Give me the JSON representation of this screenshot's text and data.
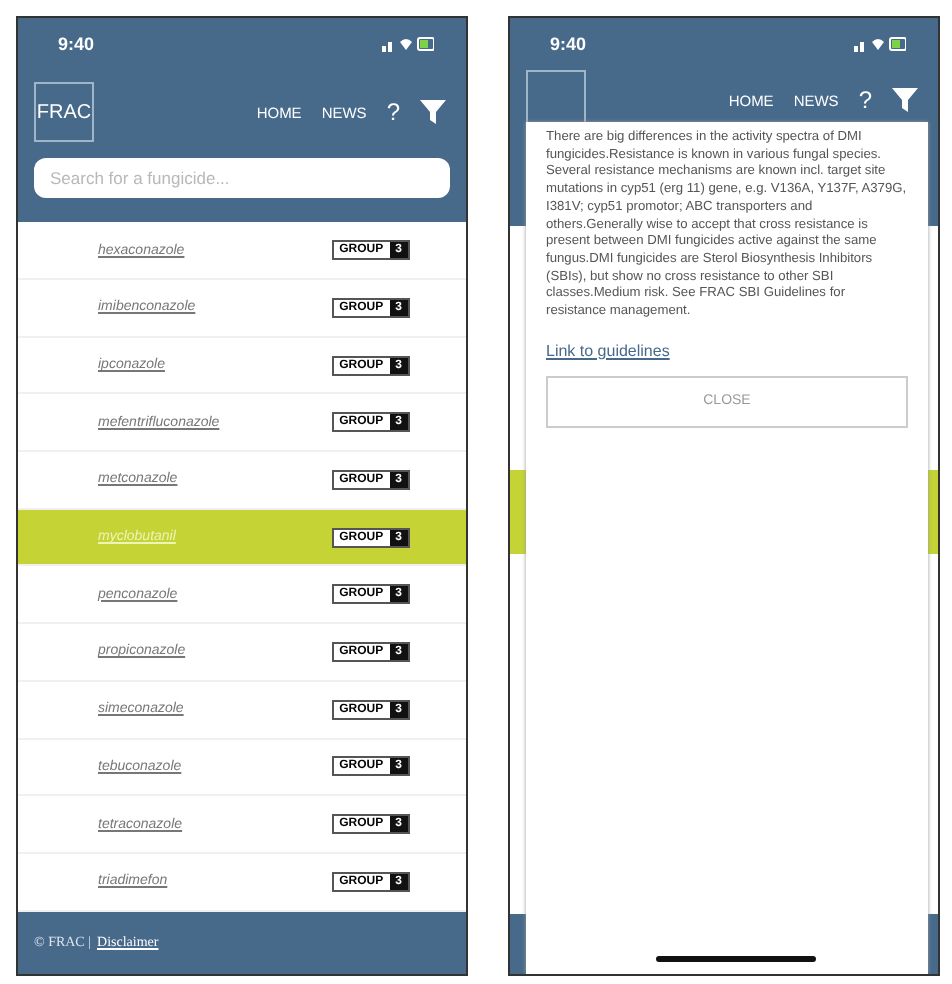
{
  "list_screen": {
    "status_time": "9:40",
    "logo": "FRAC",
    "nav": [
      {
        "label": "HOME",
        "kind": "text"
      },
      {
        "label": "NEWS",
        "kind": "text"
      },
      {
        "label": "?",
        "kind": "text"
      },
      {
        "kind": "filter"
      }
    ],
    "search": {
      "placeholder": "Search for a fungicide..."
    },
    "rows": [
      {
        "name": "hexaconazole",
        "badge": "GROUP",
        "group": "3",
        "selected": false
      },
      {
        "name": "imibenconazole",
        "badge": "GROUP",
        "group": "3",
        "selected": false
      },
      {
        "name": "ipconazole",
        "badge": "GROUP",
        "group": "3",
        "selected": false
      },
      {
        "name": "mefentrifluconazole",
        "badge": "GROUP",
        "group": "3",
        "selected": false
      },
      {
        "name": "metconazole",
        "badge": "GROUP",
        "group": "3",
        "selected": false
      },
      {
        "name": "myclobutanil",
        "badge": "GROUP",
        "group": "3",
        "selected": true
      },
      {
        "name": "penconazole",
        "badge": "GROUP",
        "group": "3",
        "selected": false
      },
      {
        "name": "propiconazole",
        "badge": "GROUP",
        "group": "3",
        "selected": false
      },
      {
        "name": "simeconazole",
        "badge": "GROUP",
        "group": "3",
        "selected": false
      },
      {
        "name": "tebuconazole",
        "badge": "GROUP",
        "group": "3",
        "selected": false
      },
      {
        "name": "tetraconazole",
        "badge": "GROUP",
        "group": "3",
        "selected": false
      },
      {
        "name": "triadimefon",
        "badge": "GROUP",
        "group": "3",
        "selected": false
      }
    ],
    "footer": {
      "copyright": "© FRAC |",
      "link": "Disclaimer"
    }
  },
  "detail_screen": {
    "status_time": "9:40",
    "nav": [
      {
        "label": "HOME",
        "kind": "text"
      },
      {
        "label": "NEWS",
        "kind": "text"
      },
      {
        "label": "?",
        "kind": "text"
      },
      {
        "kind": "filter"
      }
    ],
    "dialog": {
      "text": "There are big differences in the activity spectra of DMI fungicides.Resistance is known in various fungal species. Several resistance mechanisms are known incl. target site mutations in cyp51 (erg 11) gene, e.g. V136A, Y137F, A379G, I381V; cyp51 promotor; ABC transporters and others.Generally wise to accept that cross resistance is present between DMI fungicides active against the same fungus.DMI fungicides are Sterol Biosynthesis Inhibitors (SBIs), but show no cross resistance to other SBI classes.Medium risk. See FRAC SBI Guidelines for resistance management.",
      "link": "Link to guidelines",
      "button": "CLOSE"
    }
  }
}
